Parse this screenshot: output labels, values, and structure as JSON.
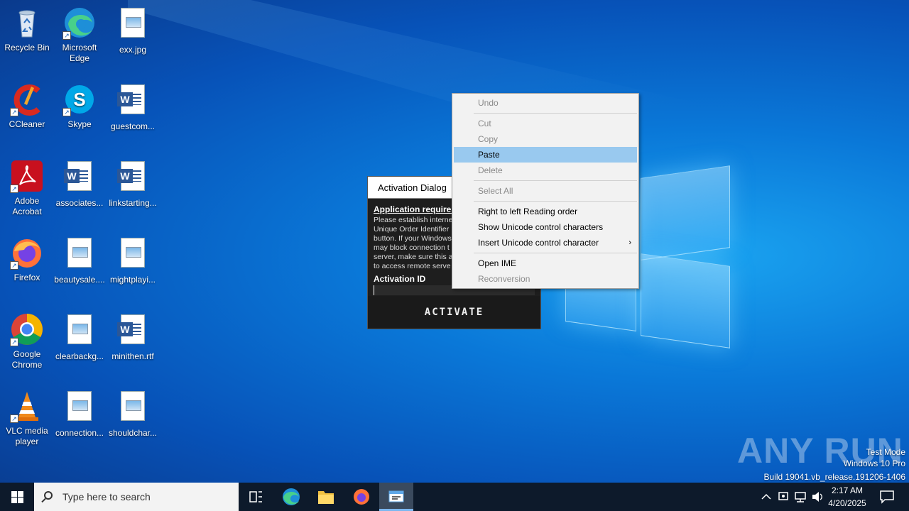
{
  "desktop": {
    "icons": [
      {
        "label": "Recycle Bin"
      },
      {
        "label": "Microsoft Edge"
      },
      {
        "label": "exx.jpg"
      },
      {
        "label": "CCleaner"
      },
      {
        "label": "Skype"
      },
      {
        "label": "guestcom..."
      },
      {
        "label": "Adobe Acrobat"
      },
      {
        "label": "associates..."
      },
      {
        "label": "linkstarting..."
      },
      {
        "label": "Firefox"
      },
      {
        "label": "beautysale...."
      },
      {
        "label": "mightplayi..."
      },
      {
        "label": "Google Chrome"
      },
      {
        "label": "clearbackg..."
      },
      {
        "label": "minithen.rtf"
      },
      {
        "label": "VLC media player"
      },
      {
        "label": "connection..."
      },
      {
        "label": "shouldchar..."
      }
    ]
  },
  "activation_dialog": {
    "title": "Activation Dialog",
    "heading": "Application requires",
    "body": "Please establish interne\nUnique Order Identifier\nbutton. If your Windows\nmay block connection t\nserver, make sure this a\nto access remote serve",
    "id_label": "Activation ID",
    "activate_label": "ACTIVATE"
  },
  "context_menu": {
    "undo": "Undo",
    "cut": "Cut",
    "copy": "Copy",
    "paste": "Paste",
    "delete": "Delete",
    "select_all": "Select All",
    "rtl": "Right to left Reading order",
    "show_unicode": "Show Unicode control characters",
    "insert_unicode": "Insert Unicode control character",
    "open_ime": "Open IME",
    "reconversion": "Reconversion"
  },
  "watermark": {
    "brand": "ANY RUN",
    "mode": "Test Mode",
    "edition": "Windows 10 Pro",
    "build": "Build 19041.vb_release.191206-1406"
  },
  "taskbar": {
    "search_placeholder": "Type here to search",
    "time": "2:17 AM",
    "date": "4/20/2025"
  },
  "colors": {
    "accent": "#99c9ef",
    "taskbar": "#0d1a2b"
  }
}
